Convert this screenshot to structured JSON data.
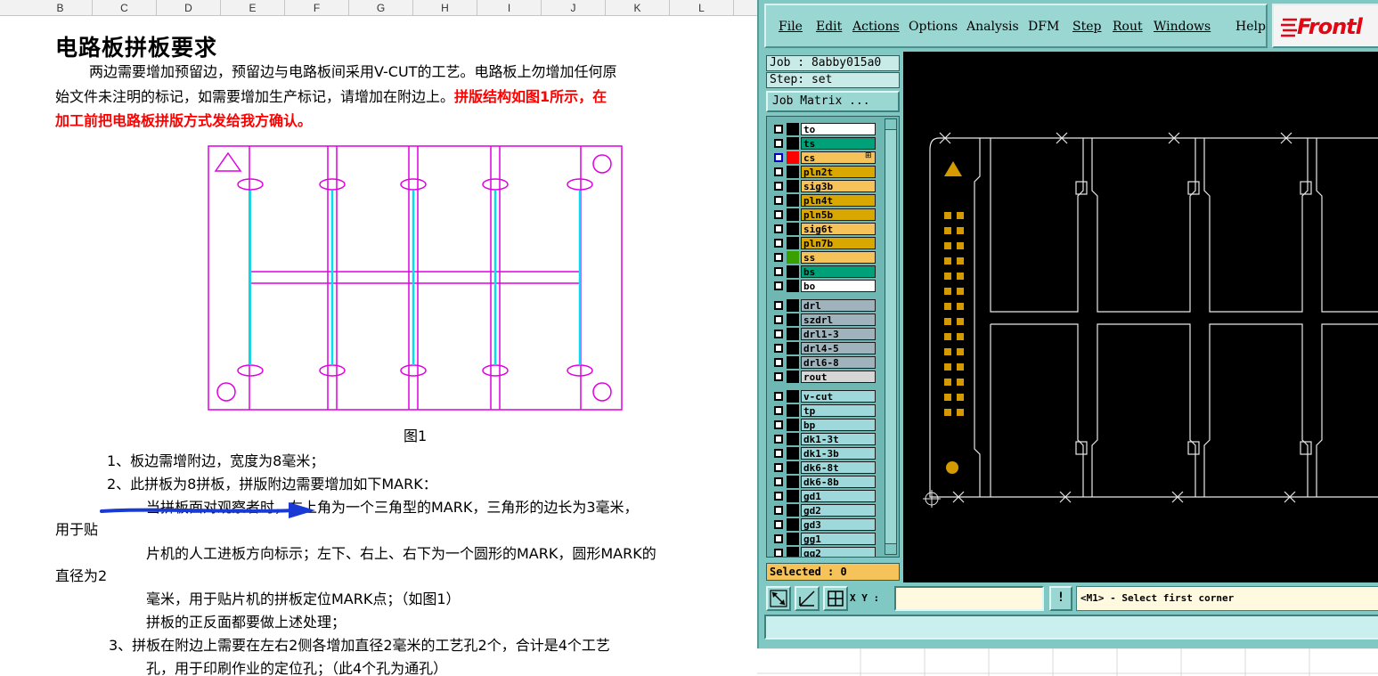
{
  "sheet": {
    "columns": [
      "B",
      "C",
      "D",
      "E",
      "F",
      "G",
      "H",
      "I",
      "J",
      "K",
      "L"
    ],
    "title": "电路板拼板要求",
    "intro_line1": "两边需要增加预留边，预留边与电路板间采用V-CUT的工艺。电路板上勿增加任何原",
    "intro_line2_plain": "始文件未注明的标记，如需要增加生产标记，请增加在附边上。",
    "intro_line2_red": "拼版结构如图1所示，在",
    "intro_line3_red": "加工前把电路板拼版方式发给我方确认。",
    "figure_caption": "图1",
    "items": [
      "1、板边需增附边，宽度为8毫米；",
      "2、此拼板为8拼板，拼版附边需要增加如下MARK：",
      "当拼板面对观察者时，左上角为一个三角型的MARK，三角形的边长为3毫米，",
      "用于贴",
      "片机的人工进板方向标示；左下、右上、右下为一个圆形的MARK，圆形MARK的",
      "直径为2",
      "毫米，用于贴片机的拼板定位MARK点；（如图1）",
      "拼板的正反面都要做上述处理；",
      "3、拼板在附边上需要在左右2侧各增加直径2毫米的工艺孔2个，合计是4个工艺",
      "孔，用于印刷作业的定位孔；（此4个孔为通孔）"
    ]
  },
  "cam": {
    "menu": [
      "File",
      "Edit",
      "Actions",
      "Options",
      "Analysis",
      "DFM",
      "Step",
      "Rout",
      "Windows",
      "Help"
    ],
    "logo": "Frontl",
    "job": "Job : 8abby015a0",
    "step": "Step: set",
    "job_matrix_button": "Job Matrix ...",
    "layers": [
      {
        "name": "to",
        "color": "#ffffff",
        "check": "normal",
        "swatch": "#000000",
        "mark": ""
      },
      {
        "name": "ts",
        "color": "#00a078",
        "check": "normal",
        "swatch": "#000000",
        "mark": ""
      },
      {
        "name": "cs",
        "color": "#f5c35a",
        "check": "blue",
        "swatch": "#ff0000",
        "mark": "⊞"
      },
      {
        "name": "pln2t",
        "color": "#d9a800",
        "check": "normal",
        "swatch": "#000000",
        "mark": ""
      },
      {
        "name": "sig3b",
        "color": "#f5c35a",
        "check": "normal",
        "swatch": "#000000",
        "mark": ""
      },
      {
        "name": "pln4t",
        "color": "#d9a800",
        "check": "normal",
        "swatch": "#000000",
        "mark": ""
      },
      {
        "name": "pln5b",
        "color": "#d9a800",
        "check": "normal",
        "swatch": "#000000",
        "mark": ""
      },
      {
        "name": "sig6t",
        "color": "#f5c35a",
        "check": "normal",
        "swatch": "#000000",
        "mark": ""
      },
      {
        "name": "pln7b",
        "color": "#d9a800",
        "check": "normal",
        "swatch": "#000000",
        "mark": ""
      },
      {
        "name": "ss",
        "color": "#f5c35a",
        "check": "normal",
        "swatch": "#3aa000",
        "mark": ""
      },
      {
        "name": "bs",
        "color": "#00a078",
        "check": "normal",
        "swatch": "#000000",
        "mark": ""
      },
      {
        "name": "bo",
        "color": "#ffffff",
        "check": "normal",
        "swatch": "#000000",
        "mark": ""
      },
      {
        "name": "drl",
        "color": "#9fb3bd",
        "check": "normal",
        "swatch": "#000000",
        "mark": "",
        "gap": true
      },
      {
        "name": "szdrl",
        "color": "#9fb3bd",
        "check": "normal",
        "swatch": "#000000",
        "mark": ""
      },
      {
        "name": "drl1-3",
        "color": "#9fb3bd",
        "check": "normal",
        "swatch": "#000000",
        "mark": ""
      },
      {
        "name": "drl4-5",
        "color": "#9fb3bd",
        "check": "normal",
        "swatch": "#000000",
        "mark": ""
      },
      {
        "name": "drl6-8",
        "color": "#9fb3bd",
        "check": "normal",
        "swatch": "#000000",
        "mark": ""
      },
      {
        "name": "rout",
        "color": "#d6d6d6",
        "check": "normal",
        "swatch": "#000000",
        "mark": ""
      },
      {
        "name": "v-cut",
        "color": "#9fd8da",
        "check": "normal",
        "swatch": "#000000",
        "mark": "",
        "gap": true
      },
      {
        "name": "tp",
        "color": "#9fd8da",
        "check": "normal",
        "swatch": "#000000",
        "mark": ""
      },
      {
        "name": "bp",
        "color": "#9fd8da",
        "check": "normal",
        "swatch": "#000000",
        "mark": ""
      },
      {
        "name": "dk1-3t",
        "color": "#9fd8da",
        "check": "normal",
        "swatch": "#000000",
        "mark": ""
      },
      {
        "name": "dk1-3b",
        "color": "#9fd8da",
        "check": "normal",
        "swatch": "#000000",
        "mark": ""
      },
      {
        "name": "dk6-8t",
        "color": "#9fd8da",
        "check": "normal",
        "swatch": "#000000",
        "mark": ""
      },
      {
        "name": "dk6-8b",
        "color": "#9fd8da",
        "check": "normal",
        "swatch": "#000000",
        "mark": ""
      },
      {
        "name": "gd1",
        "color": "#9fd8da",
        "check": "normal",
        "swatch": "#000000",
        "mark": ""
      },
      {
        "name": "gd2",
        "color": "#9fd8da",
        "check": "normal",
        "swatch": "#000000",
        "mark": ""
      },
      {
        "name": "gd3",
        "color": "#9fd8da",
        "check": "normal",
        "swatch": "#000000",
        "mark": ""
      },
      {
        "name": "gg1",
        "color": "#9fd8da",
        "check": "normal",
        "swatch": "#000000",
        "mark": ""
      },
      {
        "name": "gg2",
        "color": "#9fd8da",
        "check": "normal",
        "swatch": "#000000",
        "mark": ""
      }
    ],
    "selected": "Selected : 0",
    "xy_label": "X Y :",
    "xy_value": "",
    "excl_button": "!",
    "prompt": "<M1> - Select first corner"
  }
}
